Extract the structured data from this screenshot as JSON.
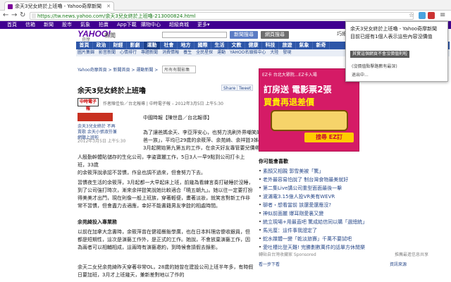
{
  "browser": {
    "tab_title": "余天3兒女終於上班嚕 - Yahoo奇摩新聞",
    "url": "https://tw.news.yahoo.com/余天3兒女終於上班嚕-213000824.html"
  },
  "yahoo_bar": {
    "items": [
      "首頁",
      "信箱",
      "新聞",
      "股市",
      "氣象",
      "拍賣",
      "App下載",
      "購物中心",
      "超級商城",
      "更多▾"
    ]
  },
  "header": {
    "logo": "YAHOO!",
    "logo_sub": "奇摩",
    "section": "新聞",
    "news_search": "新聞搜尋",
    "web_search": "網頁搜尋",
    "user": "巧維",
    "mail": "信箱"
  },
  "main_nav": [
    "首頁",
    "政治",
    "財經",
    "影劇",
    "運動",
    "社會",
    "地方",
    "國際",
    "生活",
    "文教",
    "健康",
    "科技",
    "旅遊",
    "氣象",
    "新奇"
  ],
  "sub_nav": [
    "圖片集錦",
    "影音新聞",
    "心情排行",
    "專題新聞",
    "消費情報",
    "養生",
    "全民星探",
    "運動",
    "YAHOO名頭條中心",
    "大陸",
    "發現"
  ],
  "breadcrumb": {
    "home": "Yahoo奇摩首頁",
    "news": "新聞首頁",
    "current": "運動新聞",
    "select": "所有有關影集"
  },
  "article": {
    "title": "余天3兒女終於上班嚕",
    "share": [
      "Share",
      "Tweet"
    ],
    "source_logo": "中時電子報",
    "source_text": "作者陳佳怡／台北報導 | 中時電子報 – 2012年3月5日 上午5:30",
    "side_caption": "余天3兒女終於 不再賣歌 余天小張淑芬兼網聽上班啦",
    "side_date": "2012年3月5日 上午5:30",
    "byline": "中國時報【陳世昌／台北報導】",
    "p1a": "為了讓爸媽余天、李亞萍安心，也努力洗刷外界嘲笑的「拿",
    "p1b": "爸一族」，平均已29歲的余筱萍、余苑綺、余祥銓3姊弟，",
    "p1c": "3月起開始第九第五的工作，在余天好友專管要兒價帶在…成",
    "p1d": "人殷勤幹體貼儲存的生化公司，李姿寶麗工作，5日3人一早9點到公司打卡上班，33歲",
    "p1e": "的余筱萍說承認不習慣，作息也調不過來，但會努力下去。",
    "p2": "習慣夜生活的余筱萍，3月起都一大早起床上班，前幾為看練言奏打破睡於沒睡，到了公司強打時次，漸來余祥銓笑說她比較適合「曉五朝九」。她以往一定要打扮得美美才出門，現在則像一般上班族，穿著輕便，畫著淡妝，就笑言對新工作非常不習慣，但會盡力去適應，幸好不能書籍男友李銓的相處時間。",
    "subhead": "余苑綺投入專業務",
    "p3": "以前在加拿大念書時，余筱萍曾在健福餐飯學廣，也在日本料理店傻收銀員，但都是短期性，這次是演藝工作外，是正式的工作。她說，不會放棄演藝工作，因為兩者可以相輔相成，這兩時有演藝邀約，到時候會請假去錄影。",
    "p4": "余天二女兒余苑綺昨天穿著非常OL，28歲的她曾在建設公司上班半年多，有時假日要加班，3月才上班幾天，兼新差對地以了作的"
  },
  "ad": {
    "top": "EZ卡 台北大眾院…EZ卡入場",
    "line1": "訂房送 電影票2張",
    "line2": "買貴再退差價",
    "button": "搜尋 EZ訂"
  },
  "recommended": {
    "title": "你可能會喜歡",
    "items": [
      "素顏又相親 郭雪美被「驚」",
      "老外最容易怕說了 制台灣食物最美就好",
      "第二集Live講公司重型面面最後一擊",
      "波滿電3.15億人投VR美有WEVR",
      "聊者・想看當前 該還愛還應沒?",
      "神似前面麗 爆耳剛愛裏又變",
      "統立現場+用最直吧 驚成給信同以購「選總統」",
      "馬光厘：這件事我證定了",
      "蛇水媒體一變「乾淡旅賽」千萬不要試吧",
      "愛吐槽比登天難! 完勝劃數萬件的話單方休閒樂"
    ],
    "sponsor": "轉貼自台灣收藏家 Sponsored",
    "more": "看一步下看",
    "right_note": "推薦最進信息共享",
    "right_link": "資訊來源"
  },
  "popup": {
    "title": "余天3兒女終於上班嚕 - Yahoo奇摩新聞",
    "message": "目前已經有1個人表示這些內容沒價值",
    "button": "其實這個網頁不會沒價值則啦",
    "option1": "(沒價值點擊路數有最深)",
    "option2": "退出中..."
  }
}
